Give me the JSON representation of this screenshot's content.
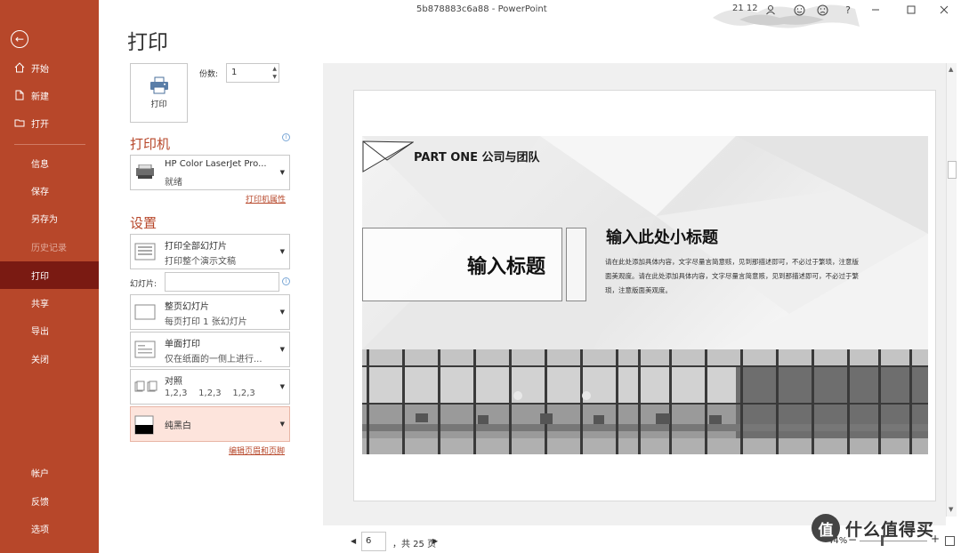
{
  "titlebar": {
    "doc_name": "5b878883c6a88",
    "separator": "-",
    "app_name": "PowerPoint",
    "time": "21 12",
    "icons": [
      "person-icon",
      "smile-icon",
      "frown-icon",
      "help-icon",
      "minimize-icon",
      "maximize-icon",
      "close-icon"
    ],
    "help": "?"
  },
  "sidebar": {
    "back_icon": "back-arrow-icon",
    "top_items": [
      {
        "label": "开始",
        "icon": "home-icon"
      },
      {
        "label": "新建",
        "icon": "new-doc-icon"
      },
      {
        "label": "打开",
        "icon": "folder-icon"
      }
    ],
    "mid_items": [
      {
        "label": "信息",
        "state": "normal"
      },
      {
        "label": "保存",
        "state": "normal"
      },
      {
        "label": "另存为",
        "state": "normal"
      },
      {
        "label": "历史记录",
        "state": "disabled"
      },
      {
        "label": "打印",
        "state": "active"
      },
      {
        "label": "共享",
        "state": "normal"
      },
      {
        "label": "导出",
        "state": "normal"
      },
      {
        "label": "关闭",
        "state": "normal"
      }
    ],
    "bottom_items": [
      {
        "label": "帐户"
      },
      {
        "label": "反馈"
      },
      {
        "label": "选项"
      }
    ]
  },
  "print": {
    "page_title": "打印",
    "print_button": "打印",
    "copies_label": "份数:",
    "copies_value": "1"
  },
  "printer": {
    "section_title": "打印机",
    "name": "HP Color LaserJet Pro...",
    "status": "就绪",
    "properties_link": "打印机属性"
  },
  "settings": {
    "section_title": "设置",
    "range": {
      "line1": "打印全部幻灯片",
      "line2": "打印整个演示文稿"
    },
    "slides_label": "幻灯片:",
    "slides_value": "",
    "layout": {
      "line1": "整页幻灯片",
      "line2": "每页打印 1 张幻灯片"
    },
    "sides": {
      "line1": "单面打印",
      "line2": "仅在纸面的一侧上进行..."
    },
    "collate": {
      "line1": "对照",
      "line2": "1,2,3    1,2,3    1,2,3"
    },
    "color": {
      "line1": "纯黑白"
    },
    "header_footer_link": "编辑页眉和页脚"
  },
  "preview": {
    "slide": {
      "part_label": "PART ONE 公司与团队",
      "title_placeholder": "输入标题",
      "subtitle": "输入此处小标题",
      "body": "请在此处添加具体内容，文字尽量言简意赅，见到那描述即可，不必过于繁琐，注意版面美观度。请在此处添加具体内容，文字尽量言简意赅，见到那描述即可，不必过于繁琐，注意版面美观度。"
    }
  },
  "pager": {
    "current_page": "6",
    "total": "，共 25 页",
    "prev": "◀",
    "next": "▶",
    "zoom": "44%",
    "zoom_minus": "−",
    "zoom_plus": "+"
  },
  "watermark": {
    "logo": "值",
    "text": "什么值得买"
  }
}
